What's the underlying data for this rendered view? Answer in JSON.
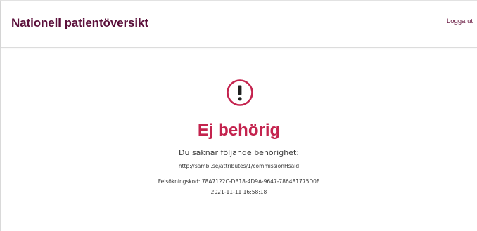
{
  "header": {
    "app_title": "Nationell patientöversikt",
    "logout_label": "Logga ut"
  },
  "error": {
    "icon": "exclamation-circle-icon",
    "title": "Ej behörig",
    "message": "Du saknar följande behörighet:",
    "permission_link": "http://sambi.se/attributes/1/commissionHsaId",
    "debug_code": "Felsökningskod: 78A7122C-DB18-4D9A-9647-786481775D0F",
    "timestamp": "2021-11-11 16:58:18"
  },
  "colors": {
    "brand": "#5b0f3a",
    "error": "#c4234e"
  }
}
